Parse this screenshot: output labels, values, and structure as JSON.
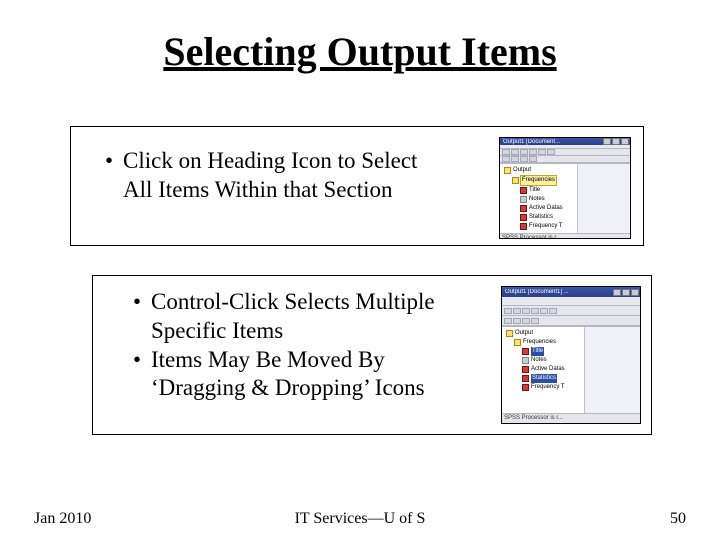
{
  "title": "Selecting Output Items",
  "block1": {
    "bullet1": "Click on Heading Icon to Select All Items Within that Section"
  },
  "block2": {
    "bullet1": "Control-Click Selects Multiple Specific Items",
    "bullet2": "Items May Be Moved By ‘Dragging & Dropping’ Icons"
  },
  "thumb1": {
    "caption": "Output1 [Document...",
    "tree": {
      "root": "Output",
      "group": "Frequencies",
      "items": [
        "Title",
        "Notes",
        "Active Datas",
        "Statistics",
        "Frequency T"
      ]
    },
    "status": "SPSS Processor is r..."
  },
  "thumb2": {
    "caption": "Output1 [Document1] ...",
    "tree": {
      "root": "Output",
      "group": "Frequencies",
      "items": [
        "Title",
        "Notes",
        "Active Datas",
        "Statistics",
        "Frequency T"
      ]
    },
    "status": "SPSS Processor is r..."
  },
  "footer": {
    "left": "Jan 2010",
    "center": "IT Services—U of S",
    "right": "50"
  }
}
